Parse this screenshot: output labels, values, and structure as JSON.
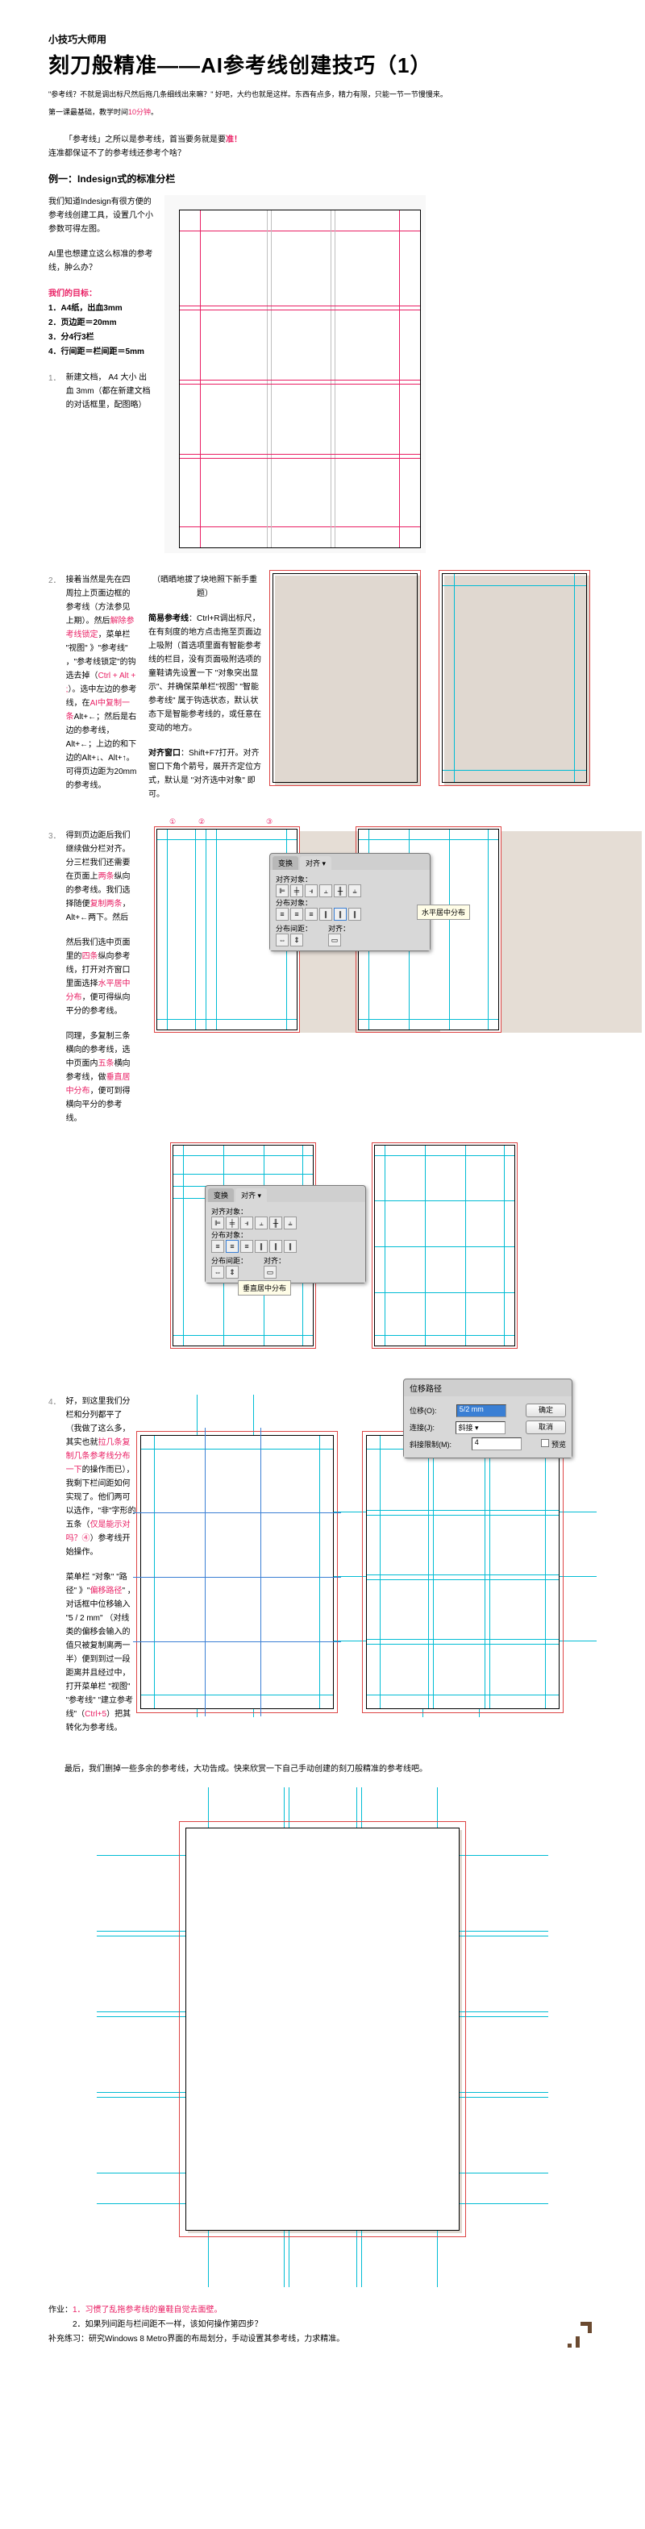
{
  "subtitle": "小技巧大师用",
  "title": "刻刀般精准——AI参考线创建技巧（1）",
  "intro_quote": "\"参考线？不就是调出标尺然后拖几条细线出来嘛？\" 好吧，大约也就是这样。东西有点多，精力有限，只能一节一节慢慢来。",
  "intro_basis": "第一课最基础，教学时间",
  "intro_time": "10分钟",
  "intro_time_suffix": "。",
  "lead_1": "「参考线」之所以是参考线，首当要务就是要",
  "lead_accent": "准！",
  "lead_2": "连准都保证不了的参考线还参考个啥？",
  "example_title": "例一：Indesign式的标准分栏",
  "s1": {
    "p1": "我们知道Indesign有很方便的参考线创建工具，设置几个小参数可得左图。",
    "p2": "AI里也想建立这么标准的参考线，肿么办？",
    "goal_label": "我们的目标：",
    "goals": [
      "1．A4纸，出血3mm",
      "2．页边距＝20mm",
      "3．分4行3栏",
      "4．行间距＝栏间距＝5mm"
    ],
    "p3": "新建文档， A4 大小 出血 3mm（都在新建文档的对话框里，配图略）"
  },
  "s2": {
    "p1a": "接着当然是先在四周拉上页面边框的参考线（方法参见上期）。然后",
    "p1b": "解除参考线锁定",
    "p1c": "，菜单栏 \"视图\" 》\"参考线\" ，\"参考线锁定\"的钩选去掉（",
    "p1d": "Ctrl + Alt + ;",
    "p1e": "）。选中左边的参考线，在",
    "p1f": "AI中复制一条",
    "p1g": "Alt+←；然后是右边的参考线，Alt+←；上边的和下边的Alt+↓、Alt+↑。可得页边距为20mm的参考线。",
    "col2_title": "（晒晒地拔了块地照下新手重题）",
    "col2_a": "简易参考线",
    "col2_a2": "：Ctrl+R调出标尺，在有刻度的地方点击拖至页面边上吸附（首选项里面有智能参考线的栏目，没有页面吸附选项的童鞋请先设置一下 \"对象突出显示\"、并确保菜单栏\"视图\" \"智能参考线\" 属于钩选状态，默认状态下是智能参考线的，或任意在变动的地方。",
    "col2_b": "对齐窗口",
    "col2_b2": "：Shift+F7打开。对齐窗口下角个箭号，展开齐定位方式，默认是 \"对齐选中对象\" 即可。"
  },
  "s3": {
    "p1a": "得到页边距后我们继续做分栏对齐。分三栏我们还需要在页面上",
    "p1b": "两条",
    "p1c": "纵向的参考线。我们选择随便",
    "p1d": "复制两条",
    "p1e": "，Alt+←两下。然后",
    "p2a": "然后我们选中页面里的",
    "p2b": "四条",
    "p2c": "纵向参考线，打开对齐窗口里面选择",
    "p2d": "水平居中分布",
    "p2e": "，便可得纵向平分的参考线。",
    "p3a": "同理，多复制三条横向的参考线，选中页面内",
    "p3b": "五条",
    "p3c": "横向参考线，做",
    "p3d": "垂直居中分布",
    "p3e": "，便可到得横向平分的参考线。",
    "dialog": {
      "tab1": "变换",
      "tab2": "对齐",
      "align_label": "对齐对象：",
      "dist_label": "分布对象：",
      "gap_label": "分布间距：",
      "align_to": "对齐：",
      "tooltip1": "水平居中分布",
      "tooltip2": "垂直居中分布"
    }
  },
  "s4": {
    "p1a": "好，到这里我们分栏和分列都平了（我做了这么多，其实也就",
    "p1b": "拉几条复制几条参考线分布一下",
    "p1c": "的操作而已），我剩下栏间距如何实现了。他们两可以选作，\"非\"字形的五条（",
    "p1d": "仅是能示对吗？④",
    "p1e": "）参考线开始操作。",
    "p2a": "菜单栏 \"对象\" \"路径\" 》\"",
    "p2b": "偏移路径",
    "p2c": "\" ，对话框中位移输入 \"5 / 2 mm\" （对线类的偏移会输入的值只被复制离两一半）便到到过一段距离并且经过中，打开菜单栏 \"视图\" \"参考线\" \"建立参考线\"（",
    "p2d": "Ctrl+5",
    "p2e": "）把其转化为参考线。",
    "offset_dialog": {
      "title": "位移路径",
      "offset_label": "位移(O):",
      "offset_value": "5/2 mm",
      "join_label": "连接(J):",
      "join_value": "斜接",
      "limit_label": "斜接限制(M):",
      "limit_value": "4",
      "ok": "确定",
      "cancel": "取消",
      "preview": "预览"
    }
  },
  "final_para": "最后，我们删掉一些多余的参考线，大功告成。快来欣赏一下自己手动创建的刻刀般精准的参考线吧。",
  "homework": {
    "label": "作业：",
    "hw1": "1．习惯了乱拖参考线的童鞋自觉去面壁。",
    "hw2": "2．如果列间距与栏间距不一样，该如何操作第四步？",
    "extra_label": "补充练习：",
    "extra": "研究Windows 8 Metro界面的布局划分，手动设置其参考线，力求精准。"
  },
  "markers": {
    "n1": "①",
    "n2": "②",
    "n3": "③"
  }
}
